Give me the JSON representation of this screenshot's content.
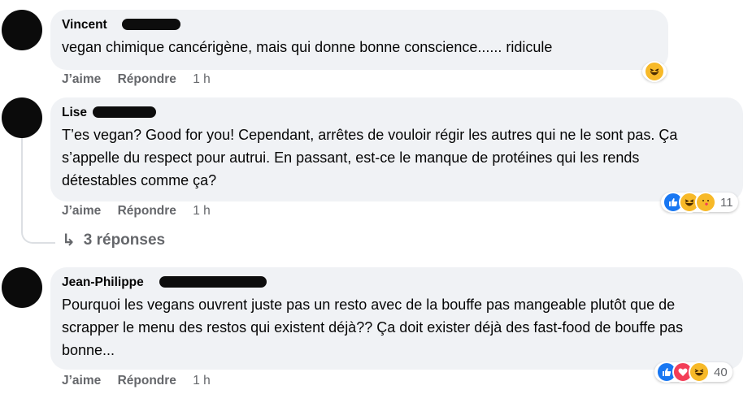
{
  "comments": [
    {
      "author": "Vincent",
      "text": "vegan chimique cancérigène, mais qui donne bonne conscience...... ridicule",
      "like_label": "J’aime",
      "reply_label": "Répondre",
      "time": "1 h",
      "reaction_icons": [
        "haha-icon"
      ]
    },
    {
      "author": "Lise",
      "text": "T’es vegan? Good for you! Cependant, arrêtes de vouloir régir les autres qui ne le sont pas. Ça s’appelle du respect pour autrui. En passant, est-ce le manque de protéines qui les rends détestables comme ça?",
      "like_label": "J’aime",
      "reply_label": "Répondre",
      "time": "1 h",
      "reaction_count": "11",
      "reaction_icons": [
        "like-icon",
        "haha-icon",
        "care-icon"
      ],
      "replies_label": "3 réponses"
    },
    {
      "author": "Jean-Philippe",
      "text": "Pourquoi les vegans ouvrent juste pas un resto avec de la bouffe pas mangeable plutôt que de scrapper le menu des restos qui existent déjà?? Ça doit exister déjà des fast-food de bouffe pas bonne...",
      "like_label": "J’aime",
      "reply_label": "Répondre",
      "time": "1 h",
      "reaction_count": "40",
      "reaction_icons": [
        "like-icon",
        "love-icon",
        "haha-icon"
      ]
    }
  ],
  "colors": {
    "bubble": "#f0f2f5",
    "meta_text": "#65676b",
    "like": "#1877f2",
    "love": "#f33e58",
    "haha": "#f7b928"
  }
}
